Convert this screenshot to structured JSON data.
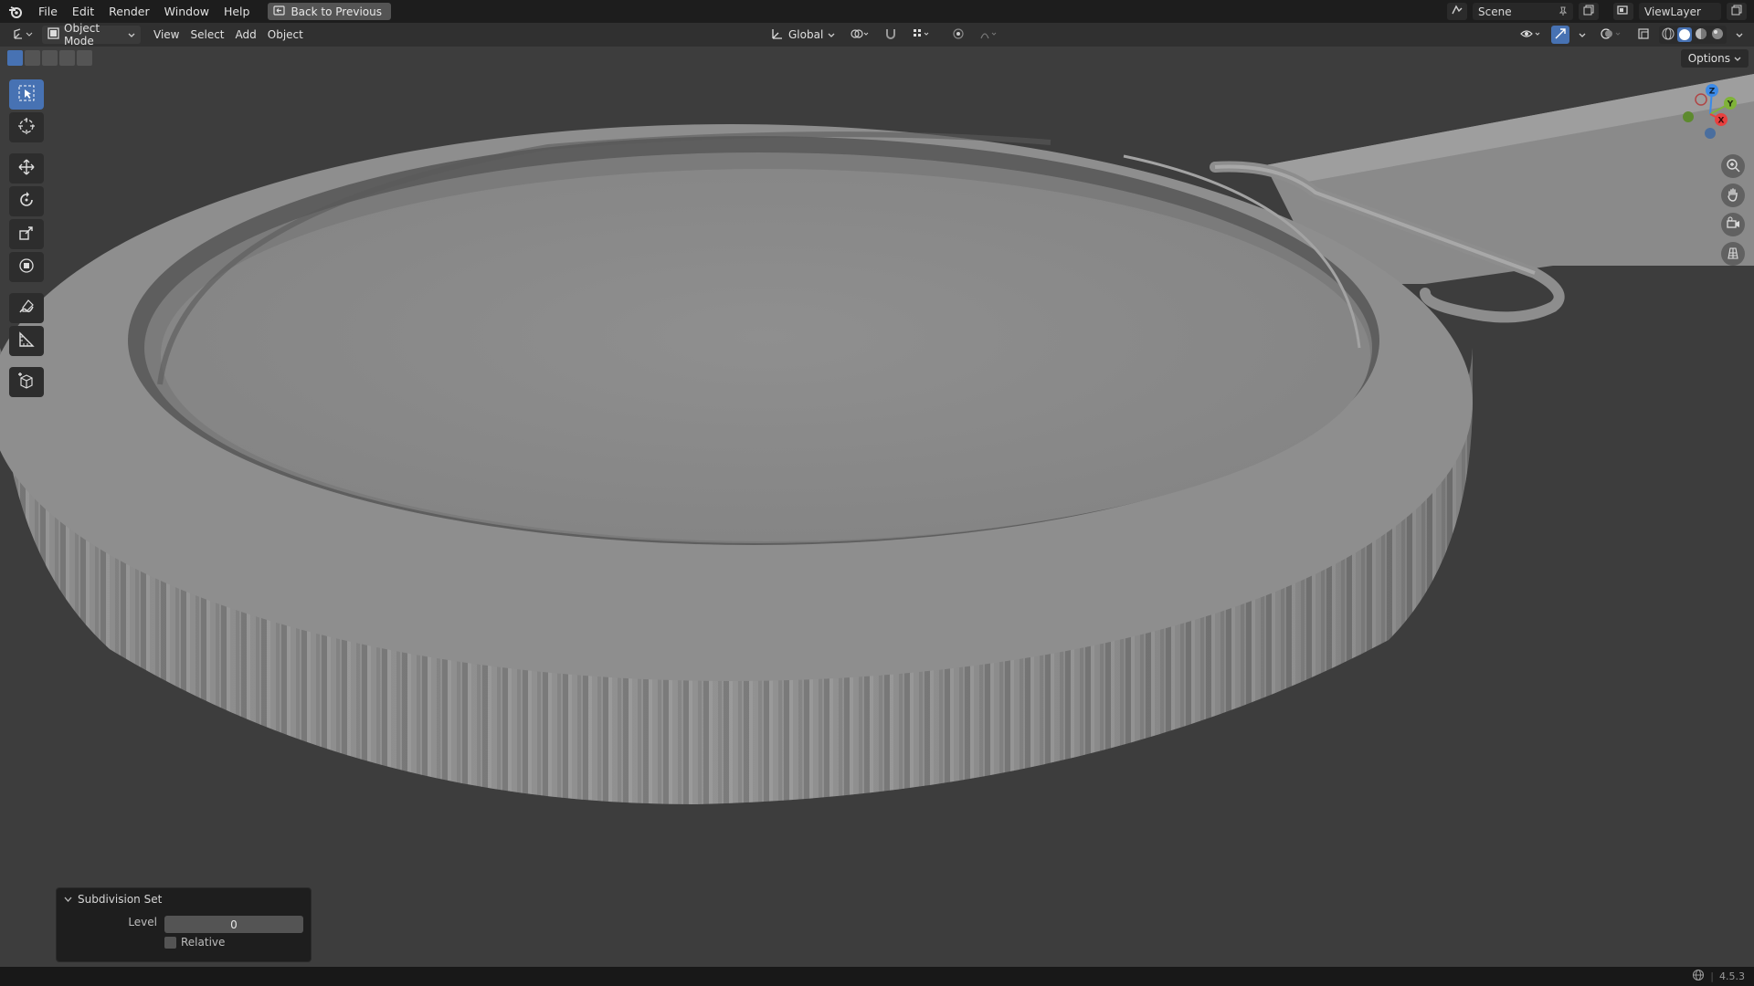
{
  "menu": {
    "items": [
      "File",
      "Edit",
      "Render",
      "Window",
      "Help"
    ],
    "back_button": "Back to Previous"
  },
  "top_right": {
    "scene": "Scene",
    "view_layer": "ViewLayer"
  },
  "viewport_header": {
    "mode": "Object Mode",
    "menus": [
      "View",
      "Select",
      "Add",
      "Object"
    ],
    "orientation": "Global"
  },
  "viewport": {
    "options_label": "Options",
    "gizmo_axes": [
      "Z",
      "Y",
      "X"
    ]
  },
  "tools": [
    "select-box-icon",
    "cursor-icon",
    "move-icon",
    "rotate-icon",
    "scale-icon",
    "transform-icon",
    "annotate-icon",
    "measure-icon",
    "add-cube-icon"
  ],
  "operator_panel": {
    "title": "Subdivision Set",
    "level_label": "Level",
    "level_value": "0",
    "relative_label": "Relative"
  },
  "status": {
    "version": "4.5.3"
  },
  "colors": {
    "accent": "#4772b3",
    "background": "#3d3d3d",
    "axis_x": "#e8403f",
    "axis_y": "#7fb338",
    "axis_z": "#3b8ae8"
  }
}
